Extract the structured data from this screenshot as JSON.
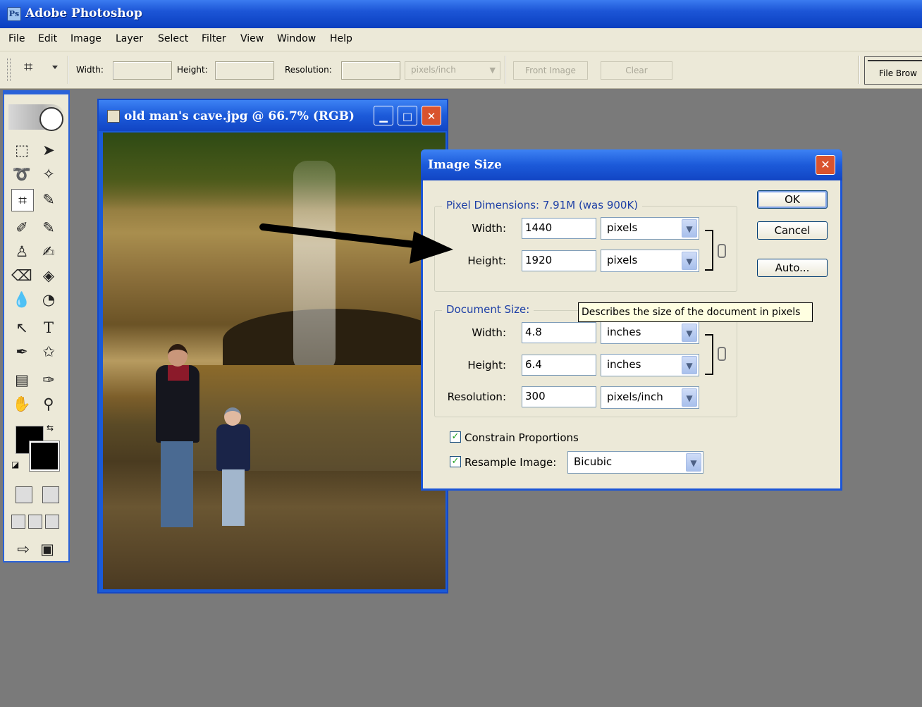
{
  "app": {
    "title": "Adobe Photoshop",
    "logo_icon": "photoshop-logo-icon"
  },
  "menu": [
    "File",
    "Edit",
    "Image",
    "Layer",
    "Select",
    "Filter",
    "View",
    "Window",
    "Help"
  ],
  "options_bar": {
    "tool_icon": "crop-tool-icon",
    "width_label": "Width:",
    "height_label": "Height:",
    "resolution_label": "Resolution:",
    "resolution_unit": "pixels/inch",
    "front_image": "Front Image",
    "clear": "Clear",
    "file_browser": "File Brow"
  },
  "document": {
    "title": "old man's cave.jpg @ 66.7% (RGB)"
  },
  "dialog": {
    "title": "Image Size",
    "pixel_dimensions": {
      "legend": "Pixel Dimensions:  7.91M (was 900K)",
      "width_label": "Width:",
      "width_value": "1440",
      "width_unit": "pixels",
      "height_label": "Height:",
      "height_value": "1920",
      "height_unit": "pixels"
    },
    "document_size": {
      "legend": "Document Size:",
      "width_label": "Width:",
      "width_value": "4.8",
      "width_unit": "inches",
      "height_label": "Height:",
      "height_value": "6.4",
      "height_unit": "inches",
      "resolution_label": "Resolution:",
      "resolution_value": "300",
      "resolution_unit": "pixels/inch"
    },
    "constrain_label": "Constrain Proportions",
    "constrain_checked": true,
    "resample_label": "Resample Image:",
    "resample_checked": true,
    "resample_method": "Bicubic",
    "buttons": {
      "ok": "OK",
      "cancel": "Cancel",
      "auto": "Auto..."
    },
    "tooltip": "Describes the size of the document in pixels"
  },
  "colors": {
    "xp_blue": "#1c5ad9",
    "dialog_bg": "#ece9d8",
    "legend_blue": "#1d3fa6"
  }
}
